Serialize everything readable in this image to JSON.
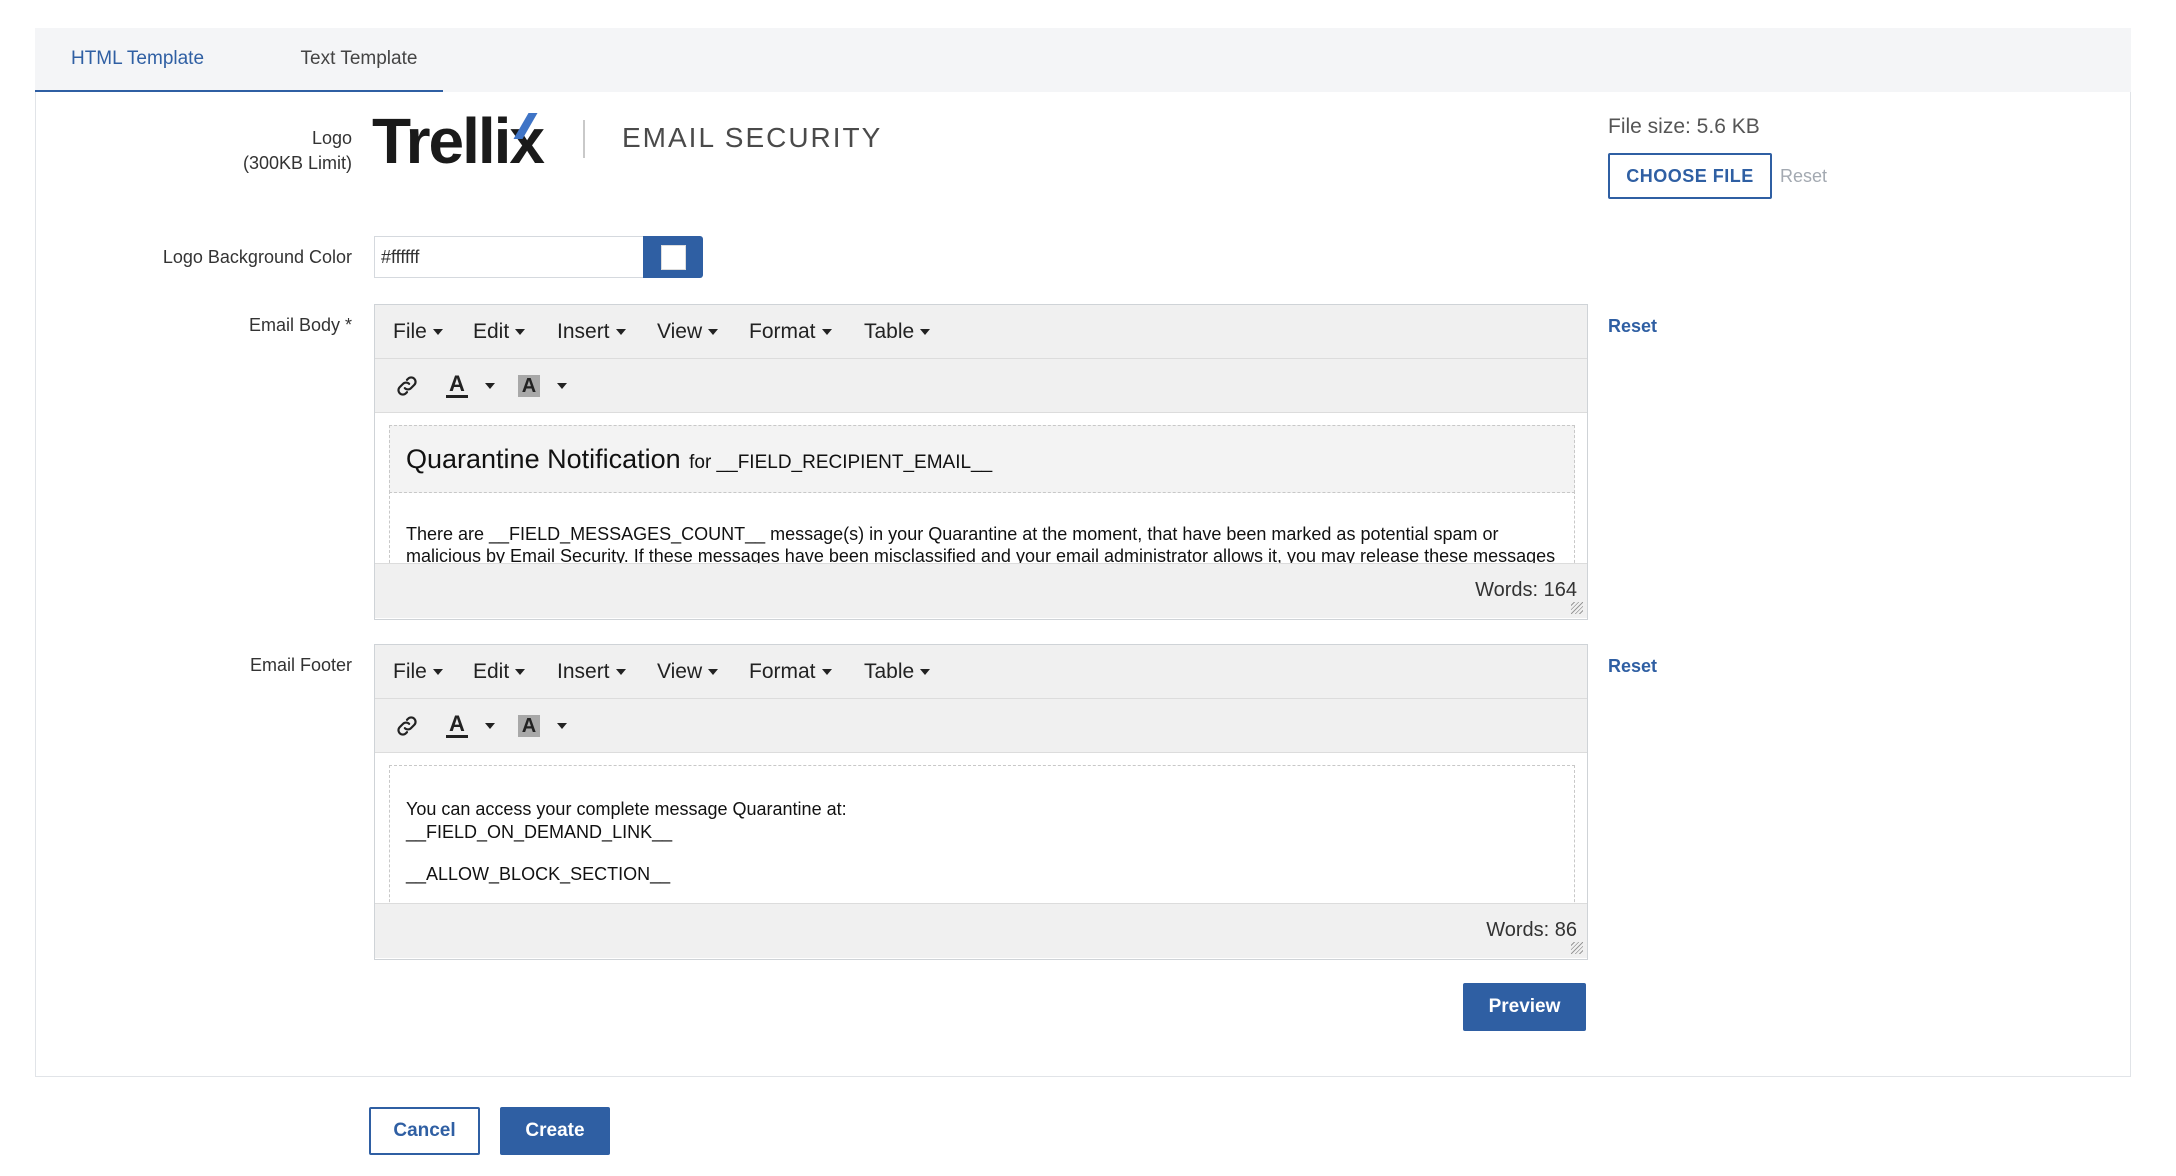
{
  "tabs": [
    {
      "label": "HTML Template",
      "active": true
    },
    {
      "label": "Text Template",
      "active": false
    }
  ],
  "logo": {
    "label": "Logo",
    "sublabel": "(300KB Limit)",
    "brand": "Trellix",
    "product": "EMAIL SECURITY",
    "file_size": "File size: 5.6 KB",
    "choose_file": "CHOOSE FILE",
    "reset": "Reset"
  },
  "logo_bg": {
    "label": "Logo Background Color",
    "value": "#ffffff"
  },
  "menu_items": [
    "File",
    "Edit",
    "Insert",
    "View",
    "Format",
    "Table"
  ],
  "email_body": {
    "label": "Email Body *",
    "reset": "Reset",
    "title": "Quarantine Notification",
    "title_suffix": "for __FIELD_RECIPIENT_EMAIL__",
    "paragraph_line1": "There are __FIELD_MESSAGES_COUNT__ message(s) in your Quarantine at the moment, that have been marked as potential spam or",
    "paragraph_line2": "malicious by Email Security. If these messages have been misclassified and your email administrator allows it, you may release these messages",
    "words": "Words: 164"
  },
  "email_footer": {
    "label": "Email Footer",
    "reset": "Reset",
    "line1": "You can access your complete message Quarantine at:",
    "line2": "__FIELD_ON_DEMAND_LINK__",
    "line3": "__ALLOW_BLOCK_SECTION__",
    "words": "Words: 86"
  },
  "buttons": {
    "preview": "Preview",
    "cancel": "Cancel",
    "create": "Create"
  },
  "colors": {
    "accent": "#2f5fa3",
    "logo_slash": "#3f74c6"
  }
}
